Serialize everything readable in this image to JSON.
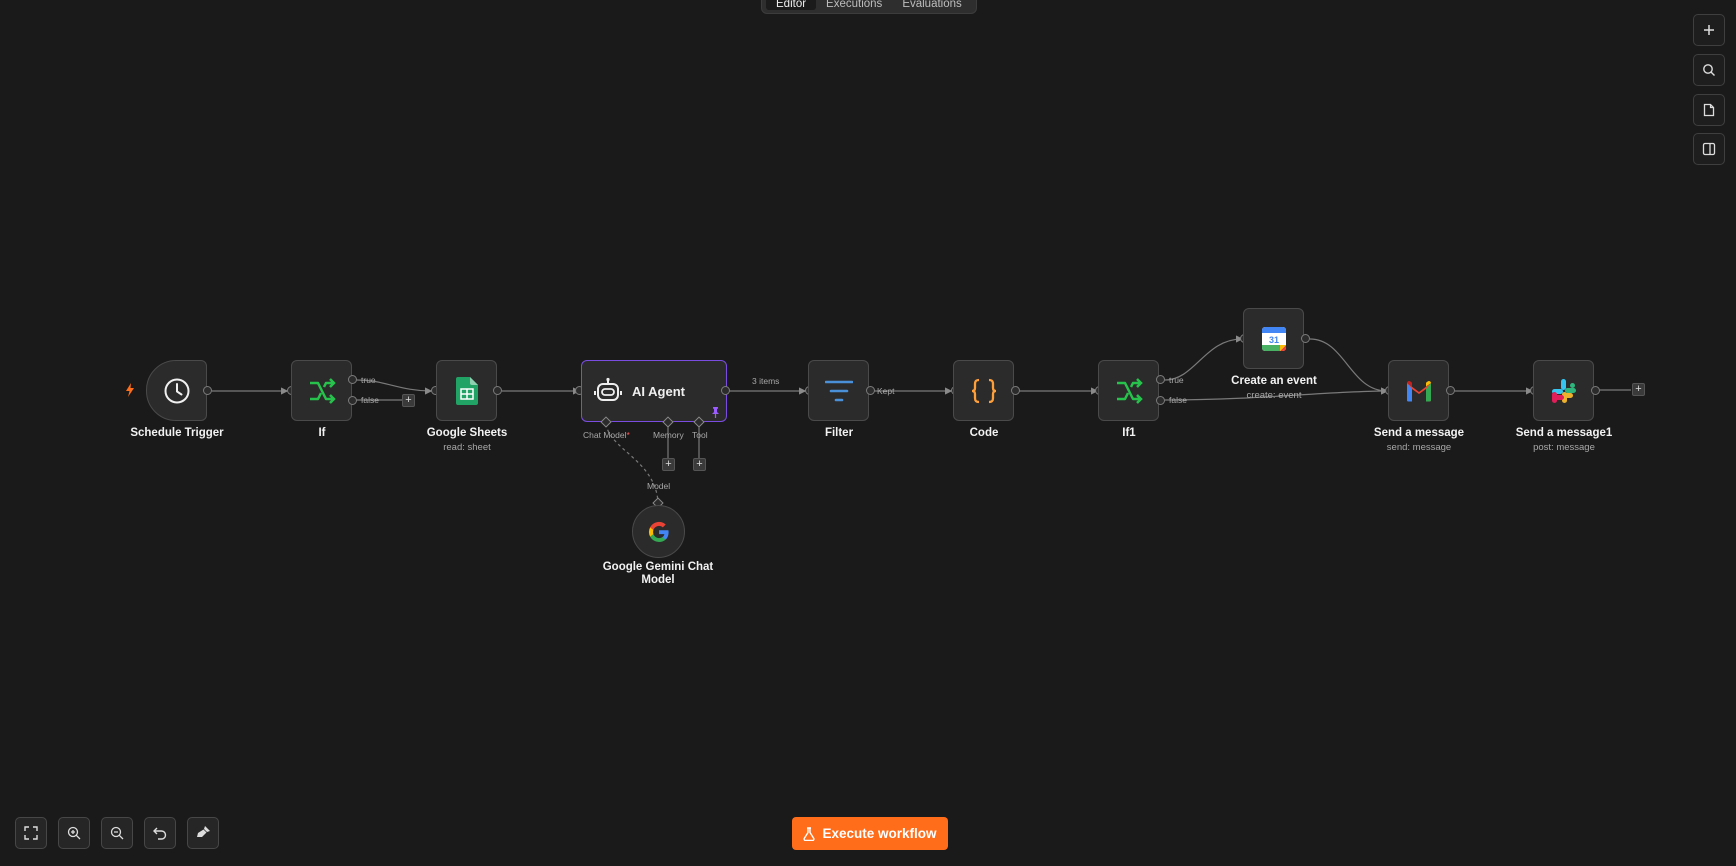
{
  "tabs": [
    {
      "label": "Editor",
      "active": true
    },
    {
      "label": "Executions",
      "active": false
    },
    {
      "label": "Evaluations",
      "active": false
    }
  ],
  "nodes": {
    "schedule_trigger": {
      "label": "Schedule Trigger",
      "icon": "clock-icon"
    },
    "if": {
      "label": "If",
      "icon": "branch-icon"
    },
    "google_sheets": {
      "label": "Google Sheets",
      "subtitle": "read: sheet",
      "icon": "google-sheets-icon"
    },
    "ai_agent": {
      "label": "AI Agent",
      "icon": "robot-icon"
    },
    "filter": {
      "label": "Filter",
      "icon": "filter-icon"
    },
    "code": {
      "label": "Code",
      "icon": "code-braces-icon"
    },
    "if1": {
      "label": "If1",
      "icon": "branch-icon"
    },
    "create_event": {
      "label": "Create an event",
      "subtitle": "create: event",
      "icon": "google-calendar-icon",
      "calendar_day": "31"
    },
    "send_message": {
      "label": "Send a message",
      "subtitle": "send: message",
      "icon": "gmail-icon"
    },
    "send_message1": {
      "label": "Send a message1",
      "subtitle": "post: message",
      "icon": "slack-icon"
    },
    "gemini": {
      "label": "Google Gemini Chat Model",
      "icon": "google-icon"
    }
  },
  "edge_labels": {
    "if_true": "true",
    "if_false": "false",
    "agent_items": "3 items",
    "filter_kept": "Kept",
    "if1_true": "true",
    "if1_false": "false",
    "chat_model": "Chat Model",
    "required_mark": "*",
    "memory": "Memory",
    "tool": "Tool",
    "model": "Model"
  },
  "plus_symbol": "+",
  "execute_button": {
    "label": "Execute workflow",
    "icon": "flask-icon"
  },
  "colors": {
    "background": "#1a1a1a",
    "accent_orange": "#ff6d1a",
    "agent_border": "#7a4de0",
    "branch_green": "#27c24c"
  }
}
